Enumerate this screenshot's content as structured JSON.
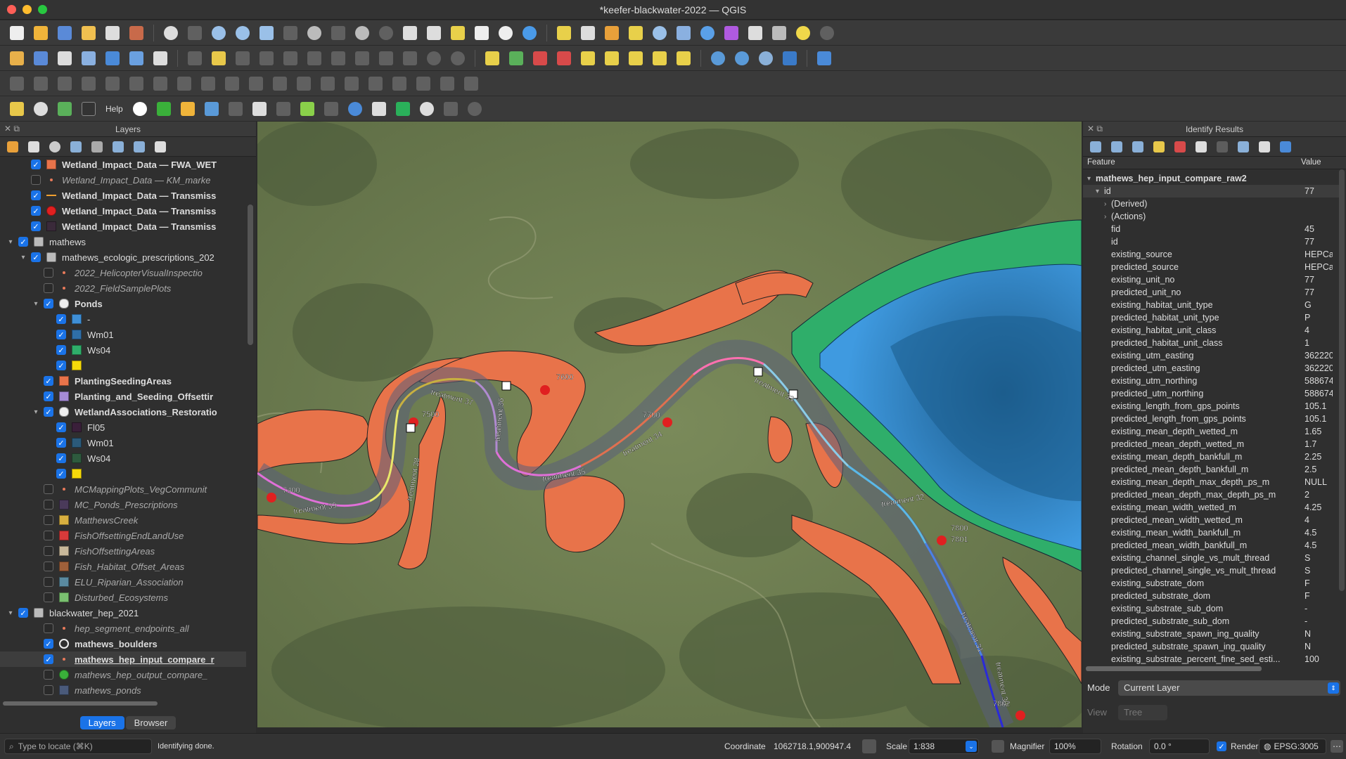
{
  "window": {
    "title": "*keefer-blackwater-2022 — QGIS"
  },
  "toolbar": {
    "help_label": "Help"
  },
  "layers_panel": {
    "title": "Layers",
    "tabs": [
      "Layers",
      "Browser"
    ],
    "rows": [
      {
        "label": "Wetland_Impact_Data — FWA_WET",
        "indent": 1,
        "checked": true,
        "swatch": "#e8734a",
        "style": "bold"
      },
      {
        "label": "Wetland_Impact_Data — KM_marke",
        "indent": 1,
        "checked": false,
        "swatch": "dot",
        "style": "ital"
      },
      {
        "label": "Wetland_Impact_Data — Transmiss",
        "indent": 1,
        "checked": true,
        "swatch": "line-orange",
        "style": "bold"
      },
      {
        "label": "Wetland_Impact_Data — Transmiss",
        "indent": 1,
        "checked": true,
        "swatch": "cross-red",
        "style": "bold"
      },
      {
        "label": "Wetland_Impact_Data — Transmiss",
        "indent": 1,
        "checked": true,
        "swatch": "#3a2a3a",
        "style": "bold"
      },
      {
        "label": "mathews",
        "indent": 0,
        "checked": true,
        "swatch": "group",
        "style": "normal",
        "expand": "open"
      },
      {
        "label": "mathews_ecologic_prescriptions_202",
        "indent": 1,
        "checked": true,
        "swatch": "group",
        "style": "normal",
        "expand": "open"
      },
      {
        "label": "2022_HelicopterVisualInspectio",
        "indent": 2,
        "checked": false,
        "swatch": "dot",
        "style": "ital"
      },
      {
        "label": "2022_FieldSamplePlots",
        "indent": 2,
        "checked": false,
        "swatch": "dot",
        "style": "ital"
      },
      {
        "label": "Ponds",
        "indent": 2,
        "checked": true,
        "swatch": "cat",
        "style": "bold",
        "expand": "open"
      },
      {
        "label": "-",
        "indent": 3,
        "checked": true,
        "swatch": "#3f8fd6",
        "style": "normal"
      },
      {
        "label": "Wm01",
        "indent": 3,
        "checked": true,
        "swatch": "#2f6fa8",
        "style": "normal"
      },
      {
        "label": "Ws04",
        "indent": 3,
        "checked": true,
        "swatch": "#2fae6a",
        "style": "normal"
      },
      {
        "label": "",
        "indent": 3,
        "checked": true,
        "swatch": "#f5d90a",
        "style": "normal"
      },
      {
        "label": "PlantingSeedingAreas",
        "indent": 2,
        "checked": true,
        "swatch": "#e8734a",
        "style": "bold"
      },
      {
        "label": "Planting_and_Seeding_Offsettir",
        "indent": 2,
        "checked": true,
        "swatch": "#a58bd6",
        "style": "bold"
      },
      {
        "label": "WetlandAssociations_Restoratio",
        "indent": 2,
        "checked": true,
        "swatch": "cat",
        "style": "bold",
        "expand": "open"
      },
      {
        "label": "Fl05",
        "indent": 3,
        "checked": true,
        "swatch": "#3a1f3a",
        "style": "normal"
      },
      {
        "label": "Wm01",
        "indent": 3,
        "checked": true,
        "swatch": "#2b5a7a",
        "style": "normal"
      },
      {
        "label": "Ws04",
        "indent": 3,
        "checked": true,
        "swatch": "#2e5a3e",
        "style": "normal"
      },
      {
        "label": "",
        "indent": 3,
        "checked": true,
        "swatch": "#f5d90a",
        "style": "normal"
      },
      {
        "label": "MCMappingPlots_VegCommunit",
        "indent": 2,
        "checked": false,
        "swatch": "dot",
        "style": "ital"
      },
      {
        "label": "MC_Ponds_Prescriptions",
        "indent": 2,
        "checked": false,
        "swatch": "#4a3a5a",
        "style": "ital"
      },
      {
        "label": "MatthewsCreek",
        "indent": 2,
        "checked": false,
        "swatch": "#d8b040",
        "style": "ital"
      },
      {
        "label": "FishOffsettingEndLandUse",
        "indent": 2,
        "checked": false,
        "swatch": "#d83a3a",
        "style": "ital"
      },
      {
        "label": "FishOffsettingAreas",
        "indent": 2,
        "checked": false,
        "swatch": "#c8b89a",
        "style": "ital"
      },
      {
        "label": "Fish_Habitat_Offset_Areas",
        "indent": 2,
        "checked": false,
        "swatch": "#a0603a",
        "style": "ital"
      },
      {
        "label": "ELU_Riparian_Association",
        "indent": 2,
        "checked": false,
        "swatch": "#5a8aa0",
        "style": "ital"
      },
      {
        "label": "Disturbed_Ecosystems",
        "indent": 2,
        "checked": false,
        "swatch": "#7ac070",
        "style": "ital"
      },
      {
        "label": "blackwater_hep_2021",
        "indent": 0,
        "checked": true,
        "swatch": "group",
        "style": "normal",
        "expand": "open"
      },
      {
        "label": "hep_segment_endpoints_all",
        "indent": 2,
        "checked": false,
        "swatch": "dot",
        "style": "ital"
      },
      {
        "label": "mathews_boulders",
        "indent": 2,
        "checked": true,
        "swatch": "ring",
        "style": "bold"
      },
      {
        "label": "mathews_hep_input_compare_r",
        "indent": 2,
        "checked": true,
        "swatch": "dot",
        "style": "bold-u",
        "selected": true
      },
      {
        "label": "mathews_hep_output_compare_",
        "indent": 2,
        "checked": false,
        "swatch": "dot-green",
        "style": "ital"
      },
      {
        "label": "mathews_ponds",
        "indent": 2,
        "checked": false,
        "swatch": "#4a5a7a",
        "style": "ital"
      }
    ]
  },
  "map": {
    "labels": [
      {
        "text": "7400"
      },
      {
        "text": "7500"
      },
      {
        "text": "7600"
      },
      {
        "text": "7700"
      },
      {
        "text": "7800"
      },
      {
        "text": "7801"
      },
      {
        "text": "7802"
      },
      {
        "text": "treatment 39"
      },
      {
        "text": "treatment 38"
      },
      {
        "text": "treatment 37"
      },
      {
        "text": "treatment 36"
      },
      {
        "text": "treatment 35"
      },
      {
        "text": "treatment 34"
      },
      {
        "text": "treatment 33"
      },
      {
        "text": "treatment 32"
      },
      {
        "text": "treatment 31"
      },
      {
        "text": "treatment 30"
      }
    ]
  },
  "identify": {
    "title": "Identify Results",
    "col_feature": "Feature",
    "col_value": "Value",
    "layer_name": "mathews_hep_input_compare_raw2",
    "root_key": "id",
    "root_value": "77",
    "derived": "(Derived)",
    "actions": "(Actions)",
    "attributes": [
      {
        "k": "fid",
        "v": "45"
      },
      {
        "k": "id",
        "v": "77"
      },
      {
        "k": "existing_source",
        "v": "HEPCalc"
      },
      {
        "k": "predicted_source",
        "v": "HEPCalc"
      },
      {
        "k": "existing_unit_no",
        "v": "77"
      },
      {
        "k": "predicted_unit_no",
        "v": "77"
      },
      {
        "k": "existing_habitat_unit_type",
        "v": "G"
      },
      {
        "k": "predicted_habitat_unit_type",
        "v": "P"
      },
      {
        "k": "existing_habitat_unit_class",
        "v": "4"
      },
      {
        "k": "predicted_habitat_unit_class",
        "v": "1"
      },
      {
        "k": "existing_utm_easting",
        "v": "362220"
      },
      {
        "k": "predicted_utm_easting",
        "v": "362220"
      },
      {
        "k": "existing_utm_northing",
        "v": "588674"
      },
      {
        "k": "predicted_utm_northing",
        "v": "588674"
      },
      {
        "k": "existing_length_from_gps_points",
        "v": "105.1"
      },
      {
        "k": "predicted_length_from_gps_points",
        "v": "105.1"
      },
      {
        "k": "existing_mean_depth_wetted_m",
        "v": "1.65"
      },
      {
        "k": "predicted_mean_depth_wetted_m",
        "v": "1.7"
      },
      {
        "k": "existing_mean_depth_bankfull_m",
        "v": "2.25"
      },
      {
        "k": "predicted_mean_depth_bankfull_m",
        "v": "2.5"
      },
      {
        "k": "existing_mean_depth_max_depth_ps_m",
        "v": "NULL"
      },
      {
        "k": "predicted_mean_depth_max_depth_ps_m",
        "v": "2"
      },
      {
        "k": "existing_mean_width_wetted_m",
        "v": "4.25"
      },
      {
        "k": "predicted_mean_width_wetted_m",
        "v": "4"
      },
      {
        "k": "existing_mean_width_bankfull_m",
        "v": "4.5"
      },
      {
        "k": "predicted_mean_width_bankfull_m",
        "v": "4.5"
      },
      {
        "k": "existing_channel_single_vs_mult_thread",
        "v": "S"
      },
      {
        "k": "predicted_channel_single_vs_mult_thread",
        "v": "S"
      },
      {
        "k": "existing_substrate_dom",
        "v": "F"
      },
      {
        "k": "predicted_substrate_dom",
        "v": "F"
      },
      {
        "k": "existing_substrate_sub_dom",
        "v": "-"
      },
      {
        "k": "predicted_substrate_sub_dom",
        "v": "-"
      },
      {
        "k": "existing_substrate_spawn_ing_quality",
        "v": "N"
      },
      {
        "k": "predicted_substrate_spawn_ing_quality",
        "v": "N"
      },
      {
        "k": "existing_substrate_percent_fine_sed_esti...",
        "v": "100"
      }
    ],
    "mode_label": "Mode",
    "mode_value": "Current Layer",
    "view_label": "View",
    "view_value": "Tree"
  },
  "status": {
    "locate_placeholder": "Type to locate (⌘K)",
    "message": "Identifying done.",
    "coordinate_label": "Coordinate",
    "coordinate_value": "1062718.1,900947.4",
    "scale_label": "Scale",
    "scale_value": "1:838",
    "magnifier_label": "Magnifier",
    "magnifier_value": "100%",
    "rotation_label": "Rotation",
    "rotation_value": "0.0 °",
    "render_label": "Render",
    "crs": "EPSG:3005"
  },
  "colors": {
    "accent": "#1a73e8",
    "orange": "#e8734a",
    "green": "#2fae6a",
    "pond_blue": "#3f8fd6"
  }
}
